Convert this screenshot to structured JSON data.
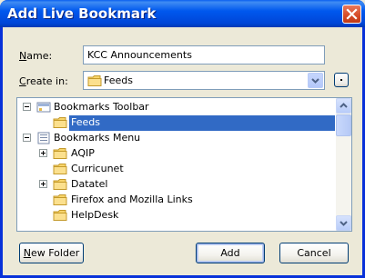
{
  "window": {
    "title": "Add Live Bookmark"
  },
  "form": {
    "name_label_mnemonic": "N",
    "name_label_rest": "ame:",
    "name_value": "KCC Announcements",
    "create_label_mnemonic": "C",
    "create_label_rest": "reate in:",
    "create_in_value": "Feeds"
  },
  "tree": {
    "rows": [
      {
        "label": "Bookmarks Toolbar",
        "icon": "bookmarks-toolbar-icon",
        "expander": "minus"
      },
      {
        "label": "Feeds",
        "icon": "folder-icon",
        "selected": true
      },
      {
        "label": "Bookmarks Menu",
        "icon": "bookmarks-menu-icon",
        "expander": "minus"
      },
      {
        "label": "AQIP",
        "icon": "folder-icon",
        "expander": "plus"
      },
      {
        "label": "Curricunet",
        "icon": "folder-icon"
      },
      {
        "label": "Datatel",
        "icon": "folder-icon",
        "expander": "plus"
      },
      {
        "label": "Firefox and Mozilla Links",
        "icon": "folder-icon"
      },
      {
        "label": "HelpDesk",
        "icon": "folder-icon"
      }
    ]
  },
  "buttons": {
    "new_folder_mnemonic": "N",
    "new_folder_rest": "ew Folder",
    "add": "Add",
    "cancel": "Cancel"
  },
  "colors": {
    "titlebar": "#0058EE",
    "selection": "#316AC5",
    "dialog_bg": "#ECE9D8"
  }
}
